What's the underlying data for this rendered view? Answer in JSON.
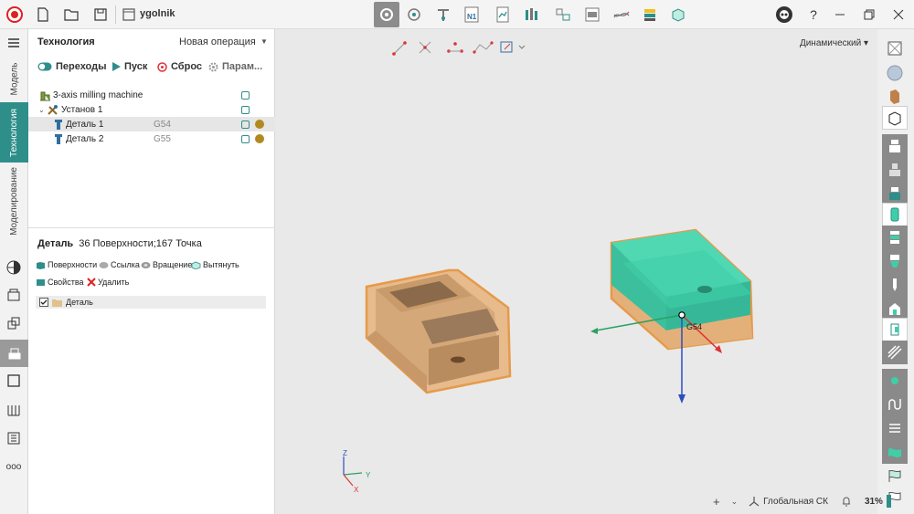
{
  "topbar": {
    "doc_title": "ygolnik",
    "icons": [
      "app-logo-icon",
      "new-file-icon",
      "open-folder-icon",
      "save-icon",
      "document-icon",
      "fixture-icon",
      "probe-icon",
      "tool-icon",
      "nc-program-icon",
      "report-icon",
      "tool-library-icon",
      "machine-icon",
      "simulation-icon",
      "toolpath-icon",
      "stock-icon",
      "export-icon",
      "avatar-icon",
      "help-icon",
      "minimize-icon",
      "restore-icon",
      "close-icon"
    ],
    "nc_label": "N1"
  },
  "rail": {
    "tabs": [
      {
        "label": "Модель",
        "active": false
      },
      {
        "label": "Технология",
        "active": true
      },
      {
        "label": "Моделирование",
        "active": false
      }
    ]
  },
  "panel": {
    "title": "Технология",
    "new_operation": "Новая операция",
    "actions": {
      "transitions": "Переходы",
      "run": "Пуск",
      "reset": "Сброс",
      "params": "Парам..."
    },
    "tree": [
      {
        "label": "3-axis milling machine",
        "extra": "",
        "indent": 0
      },
      {
        "label": "Установ 1",
        "extra": "",
        "indent": 1
      },
      {
        "label": "Деталь 1",
        "extra": "G54",
        "indent": 2,
        "selected": true
      },
      {
        "label": "Деталь 2",
        "extra": "G55",
        "indent": 2
      }
    ],
    "detail": {
      "title": "Деталь",
      "info": "36 Поверхности;167 Точка",
      "actions": [
        "Поверхности",
        "Ссылка",
        "Вращение",
        "Вытянуть",
        "Свойства",
        "Удалить"
      ],
      "list_item": "Деталь"
    }
  },
  "viewport": {
    "view_mode": "Динамический",
    "triad": {
      "z": "Z",
      "y": "Y",
      "x": "X"
    },
    "csys_label": "G54"
  },
  "status": {
    "coord_system": "Глобальная СК",
    "zoom": "31%"
  },
  "colors": {
    "accent": "#2e8e8a",
    "part": "#d9a878",
    "stock": "#3fcfa8",
    "marker": "#b08a1e"
  }
}
